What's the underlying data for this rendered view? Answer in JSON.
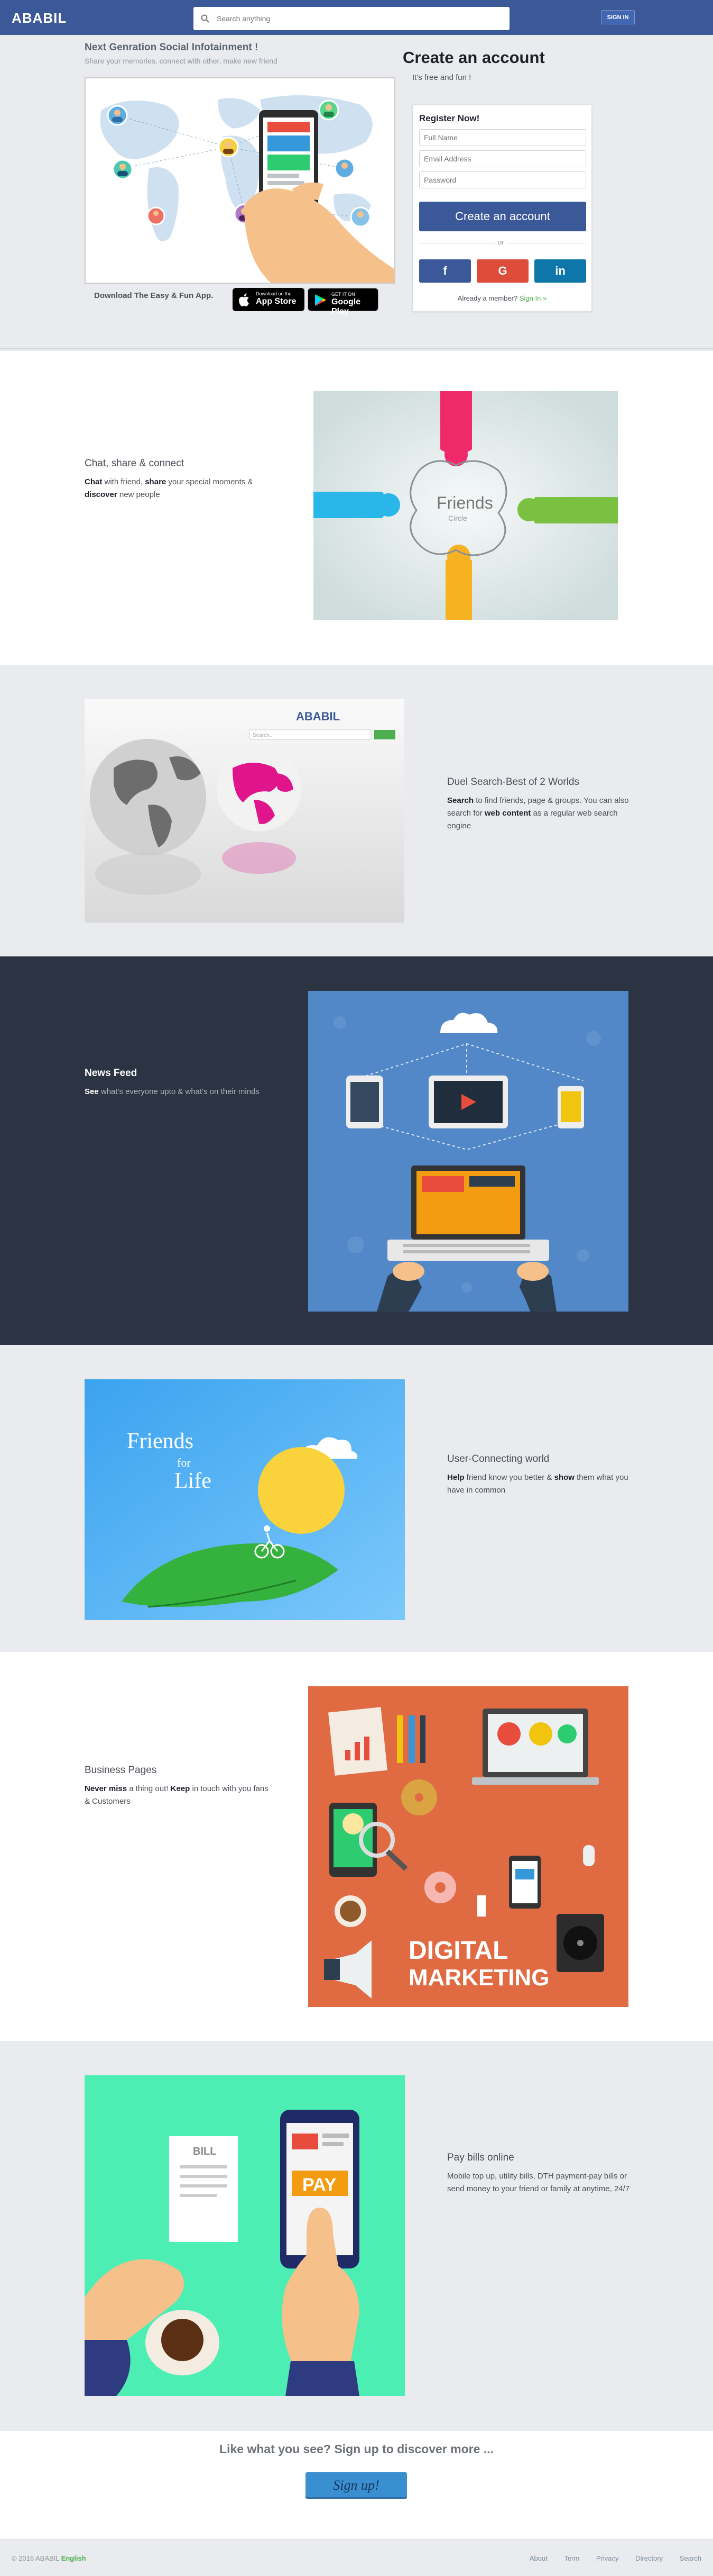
{
  "header": {
    "logo": "ABABIL",
    "search_placeholder": "Search anything",
    "signin_label": "SIGN IN"
  },
  "hero": {
    "title": "Next Genration Social Infotainment !",
    "subtitle": "Share your memories, connect with other, make new friend",
    "download_text": "Download The Easy & Fun App.",
    "app_store": {
      "small": "Download on the",
      "big": "App Store"
    },
    "google_play": {
      "small": "GET IT ON",
      "big": "Google Play"
    }
  },
  "register": {
    "heading": "Create an account",
    "subheading": "It's free and fun !",
    "card_title": "Register Now!",
    "fullname_placeholder": "Full Name",
    "email_placeholder": "Email Address",
    "password_placeholder": "Password",
    "create_label": "Create an account",
    "or_label": "or",
    "facebook_label": "f",
    "google_label": "G",
    "linkedin_label": "in",
    "member_text": "Already a member?",
    "signin_link": "Sign In »"
  },
  "features": [
    {
      "title": "Chat, share & connect",
      "desc_parts": [
        "Chat",
        " with friend, ",
        "share",
        " your special moments & ",
        "discover",
        " new people"
      ],
      "image_text": "Friends",
      "image_sub": "Circle"
    },
    {
      "title": "Duel Search-Best of 2 Worlds",
      "desc_parts": [
        "Search",
        " to find friends, page & groups. You can also search for ",
        "web content",
        " as a regular web search engine"
      ],
      "image_logo": "ABABIL",
      "image_search": "Search..."
    },
    {
      "title": "News Feed",
      "desc_parts": [
        "See",
        " what's everyone upto & what's on their minds"
      ]
    },
    {
      "title": "User-Connecting world",
      "desc_parts": [
        "Help",
        " friend know you better & ",
        "show",
        " them what you have in common"
      ],
      "image_text": "Friends",
      "image_sub": "for",
      "image_sub2": "Life"
    },
    {
      "title": "Business Pages",
      "desc_parts": [
        "Never miss",
        " a thing out! ",
        "Keep",
        " in touch with you fans & Customers"
      ],
      "image_text": "DIGITAL",
      "image_text2": "MARKETING"
    },
    {
      "title": "Pay bills online",
      "desc_parts": [
        "",
        "Mobile top up, utility bills, DTH payment-pay bills or send money to your friend or family at anytime, 24/7"
      ],
      "image_bill": "BILL",
      "image_pay": "PAY"
    }
  ],
  "cta": {
    "text": "Like what you see? Sign up to discover more ...",
    "signup_label": "Sign up!"
  },
  "footer": {
    "copyright": "© 2016 ABABIL",
    "language": "English",
    "links": [
      "About",
      "Term",
      "Privacy",
      "Directory",
      "Search"
    ]
  },
  "colors": {
    "brand": "#3b5998",
    "facebook": "#3b5998",
    "google": "#dd4b39",
    "linkedin": "#0e76a8",
    "dark_section": "#2c3444",
    "accent_green": "#4cae4c"
  }
}
